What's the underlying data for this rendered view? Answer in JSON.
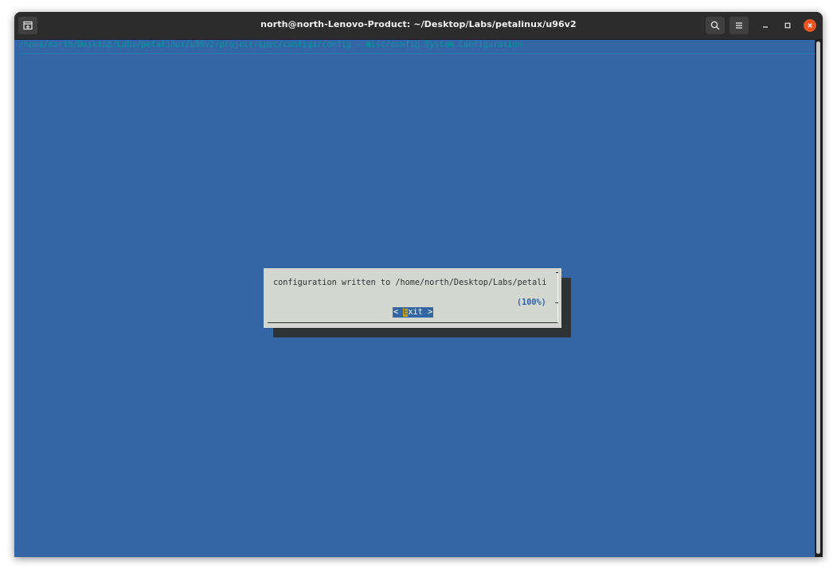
{
  "window": {
    "title": "north@north-Lenovo-Product: ~/Desktop/Labs/petalinux/u96v2"
  },
  "icons": {
    "new_tab": "new-tab-icon",
    "search": "search-icon",
    "menu": "hamburger-menu-icon",
    "minimize": "minimize-icon",
    "maximize": "maximize-icon",
    "close": "close-icon"
  },
  "colors": {
    "terminal_bg": "#3465a4",
    "backtitle": "#06989a",
    "dialog_bg": "#d3d7cf",
    "close_accent": "#e95420"
  },
  "terminal": {
    "backtitle": "/home/north/Desktop/Labs/petalinux/u96v2/project-spec/configs/config - misc/config System Configuration",
    "dialog": {
      "message": "configuration written to /home/north/Desktop/Labs/petali",
      "progress": "(100%)",
      "exit_button": {
        "left": "< ",
        "hotkey": "E",
        "rest": "xit >"
      }
    }
  }
}
